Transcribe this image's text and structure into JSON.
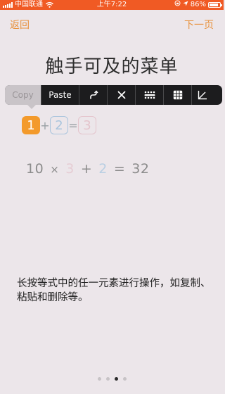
{
  "status_bar": {
    "carrier": "中国联通",
    "time": "上午7:22",
    "battery": "86%",
    "battery_level": 0.86
  },
  "nav": {
    "back": "返回",
    "next": "下一页"
  },
  "title": "触手可及的菜单",
  "edit_menu": {
    "items": [
      "Copy",
      "Paste"
    ],
    "icons": [
      "curve-arrow-icon",
      "close-icon",
      "operator-icon",
      "grid-icon",
      "angle-icon"
    ]
  },
  "tokens": {
    "first": "1",
    "plus": "+",
    "second": "2",
    "equals": "=",
    "third": "3"
  },
  "expression": {
    "ten": "10",
    "times": "×",
    "three": "3",
    "plus": "+",
    "two": "2",
    "equals": "=",
    "result": "32"
  },
  "description": "长按等式中的任一元素进行操作，如复制、粘贴和删除等。",
  "pager": {
    "count": 4,
    "active_index": 2
  },
  "colors": {
    "status_bar": "#f05a24",
    "accent": "#e8913c",
    "background": "#ece6ea",
    "menu": "#1c1c1e",
    "token_selected": "#f39a2b"
  }
}
